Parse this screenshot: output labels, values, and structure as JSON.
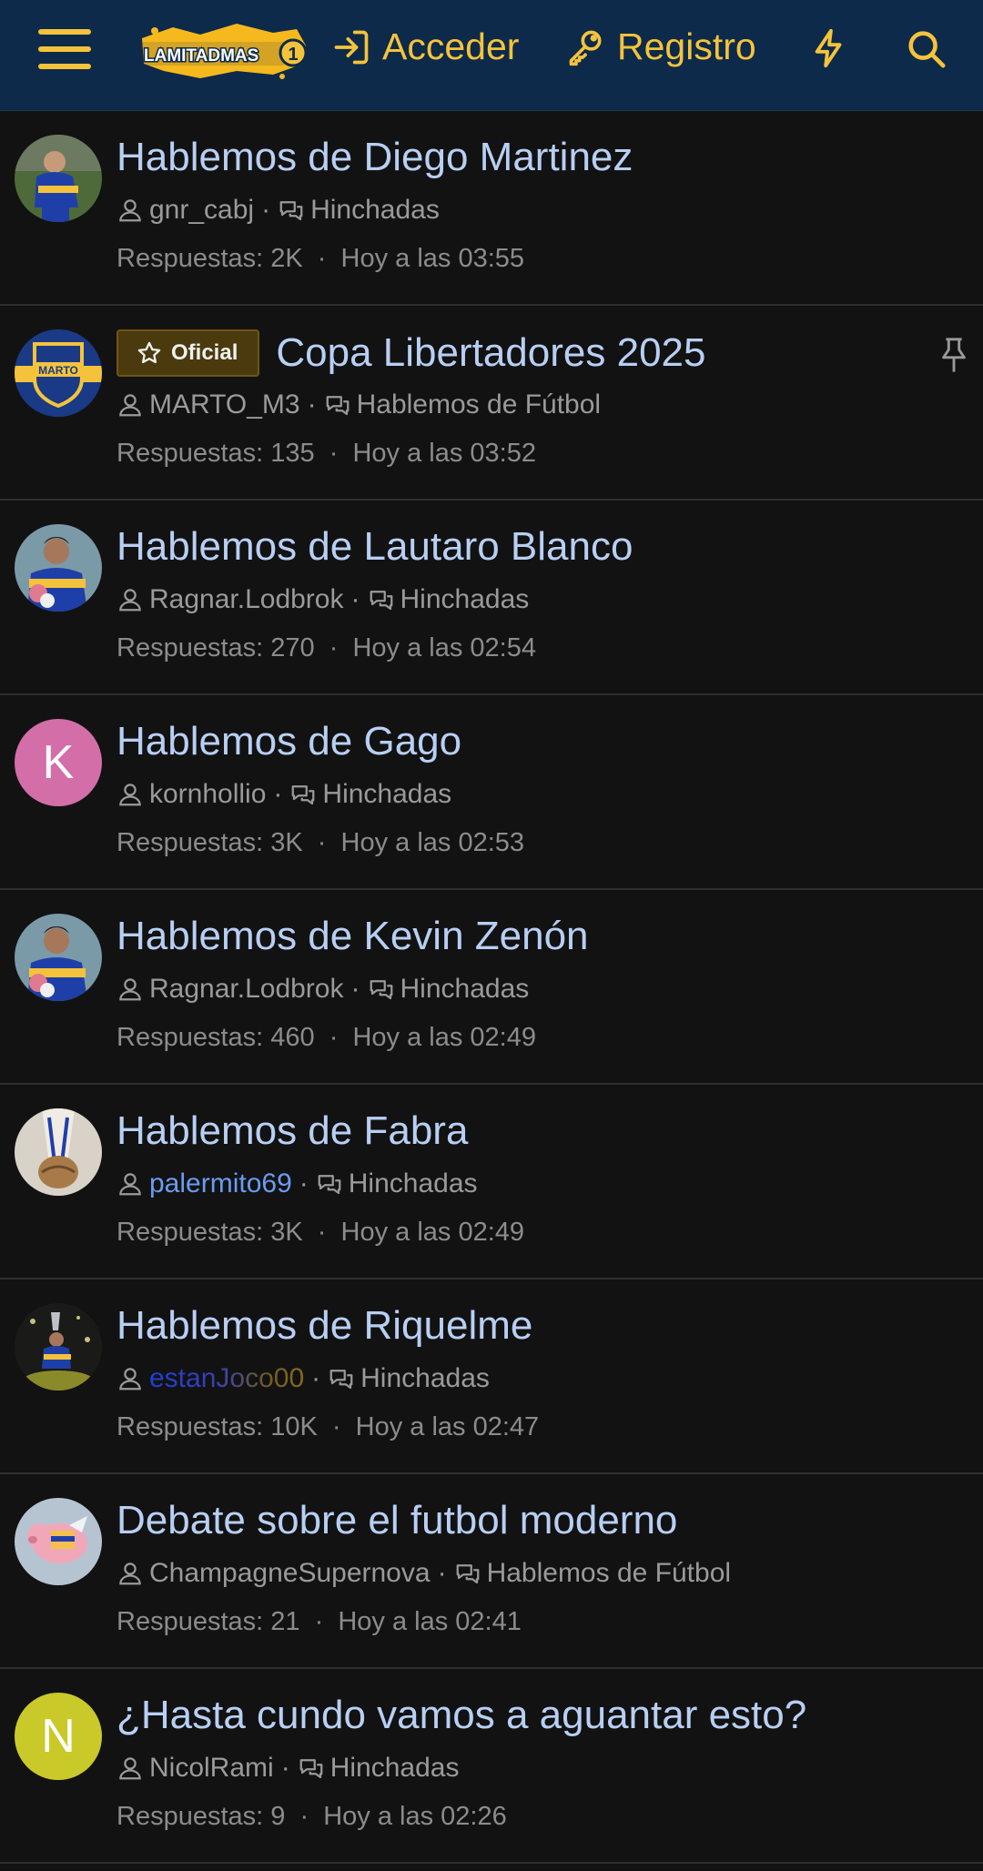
{
  "header": {
    "logo_text": "LAMITADMAS1",
    "acceder_label": "Acceder",
    "registro_label": "Registro",
    "accent_color": "#f5c33b",
    "background_color": "#0d2a4a"
  },
  "threads": [
    {
      "title": "Hablemos de Diego Martinez",
      "user": "gnr_cabj",
      "forum": "Hinchadas",
      "replies": "Respuestas: 2K",
      "time": "Hoy a las 03:55",
      "avatar": "photo"
    },
    {
      "badge": "Oficial",
      "title": "Copa Libertadores 2025",
      "user": "MARTO_M3",
      "forum": "Hablemos de Fútbol",
      "replies": "Respuestas: 135",
      "time": "Hoy a las 03:52",
      "avatar": "crest",
      "avatar_text": "MARTO",
      "pinned": true
    },
    {
      "title": "Hablemos de Lautaro Blanco",
      "user": "Ragnar.Lodbrok",
      "forum": "Hinchadas",
      "replies": "Respuestas: 270",
      "time": "Hoy a las 02:54",
      "avatar": "photo"
    },
    {
      "title": "Hablemos de Gago",
      "user": "kornhollio",
      "forum": "Hinchadas",
      "replies": "Respuestas: 3K",
      "time": "Hoy a las 02:53",
      "avatar": "letter",
      "avatar_letter": "K",
      "avatar_color": "#d36ea8"
    },
    {
      "title": "Hablemos de Kevin Zenón",
      "user": "Ragnar.Lodbrok",
      "forum": "Hinchadas",
      "replies": "Respuestas: 460",
      "time": "Hoy a las 02:49",
      "avatar": "photo"
    },
    {
      "title": "Hablemos de Fabra",
      "user": "palermito69",
      "forum": "Hinchadas",
      "replies": "Respuestas: 3K",
      "time": "Hoy a las 02:49",
      "avatar": "photo"
    },
    {
      "title": "Hablemos de Riquelme",
      "user": "estanJoco00",
      "forum": "Hinchadas",
      "replies": "Respuestas: 10K",
      "time": "Hoy a las 02:47",
      "avatar": "photo"
    },
    {
      "title": "Debate sobre el futbol moderno",
      "user": "ChampagneSupernova",
      "forum": "Hablemos de Fútbol",
      "replies": "Respuestas: 21",
      "time": "Hoy a las 02:41",
      "avatar": "photo"
    },
    {
      "title": "¿Hasta cundo vamos a aguantar esto?",
      "user": "NicolRami",
      "forum": "Hinchadas",
      "replies": "Respuestas: 9",
      "time": "Hoy a las 02:26",
      "avatar": "letter",
      "avatar_letter": "N",
      "avatar_color": "#c9c92a"
    }
  ],
  "separator": "·"
}
